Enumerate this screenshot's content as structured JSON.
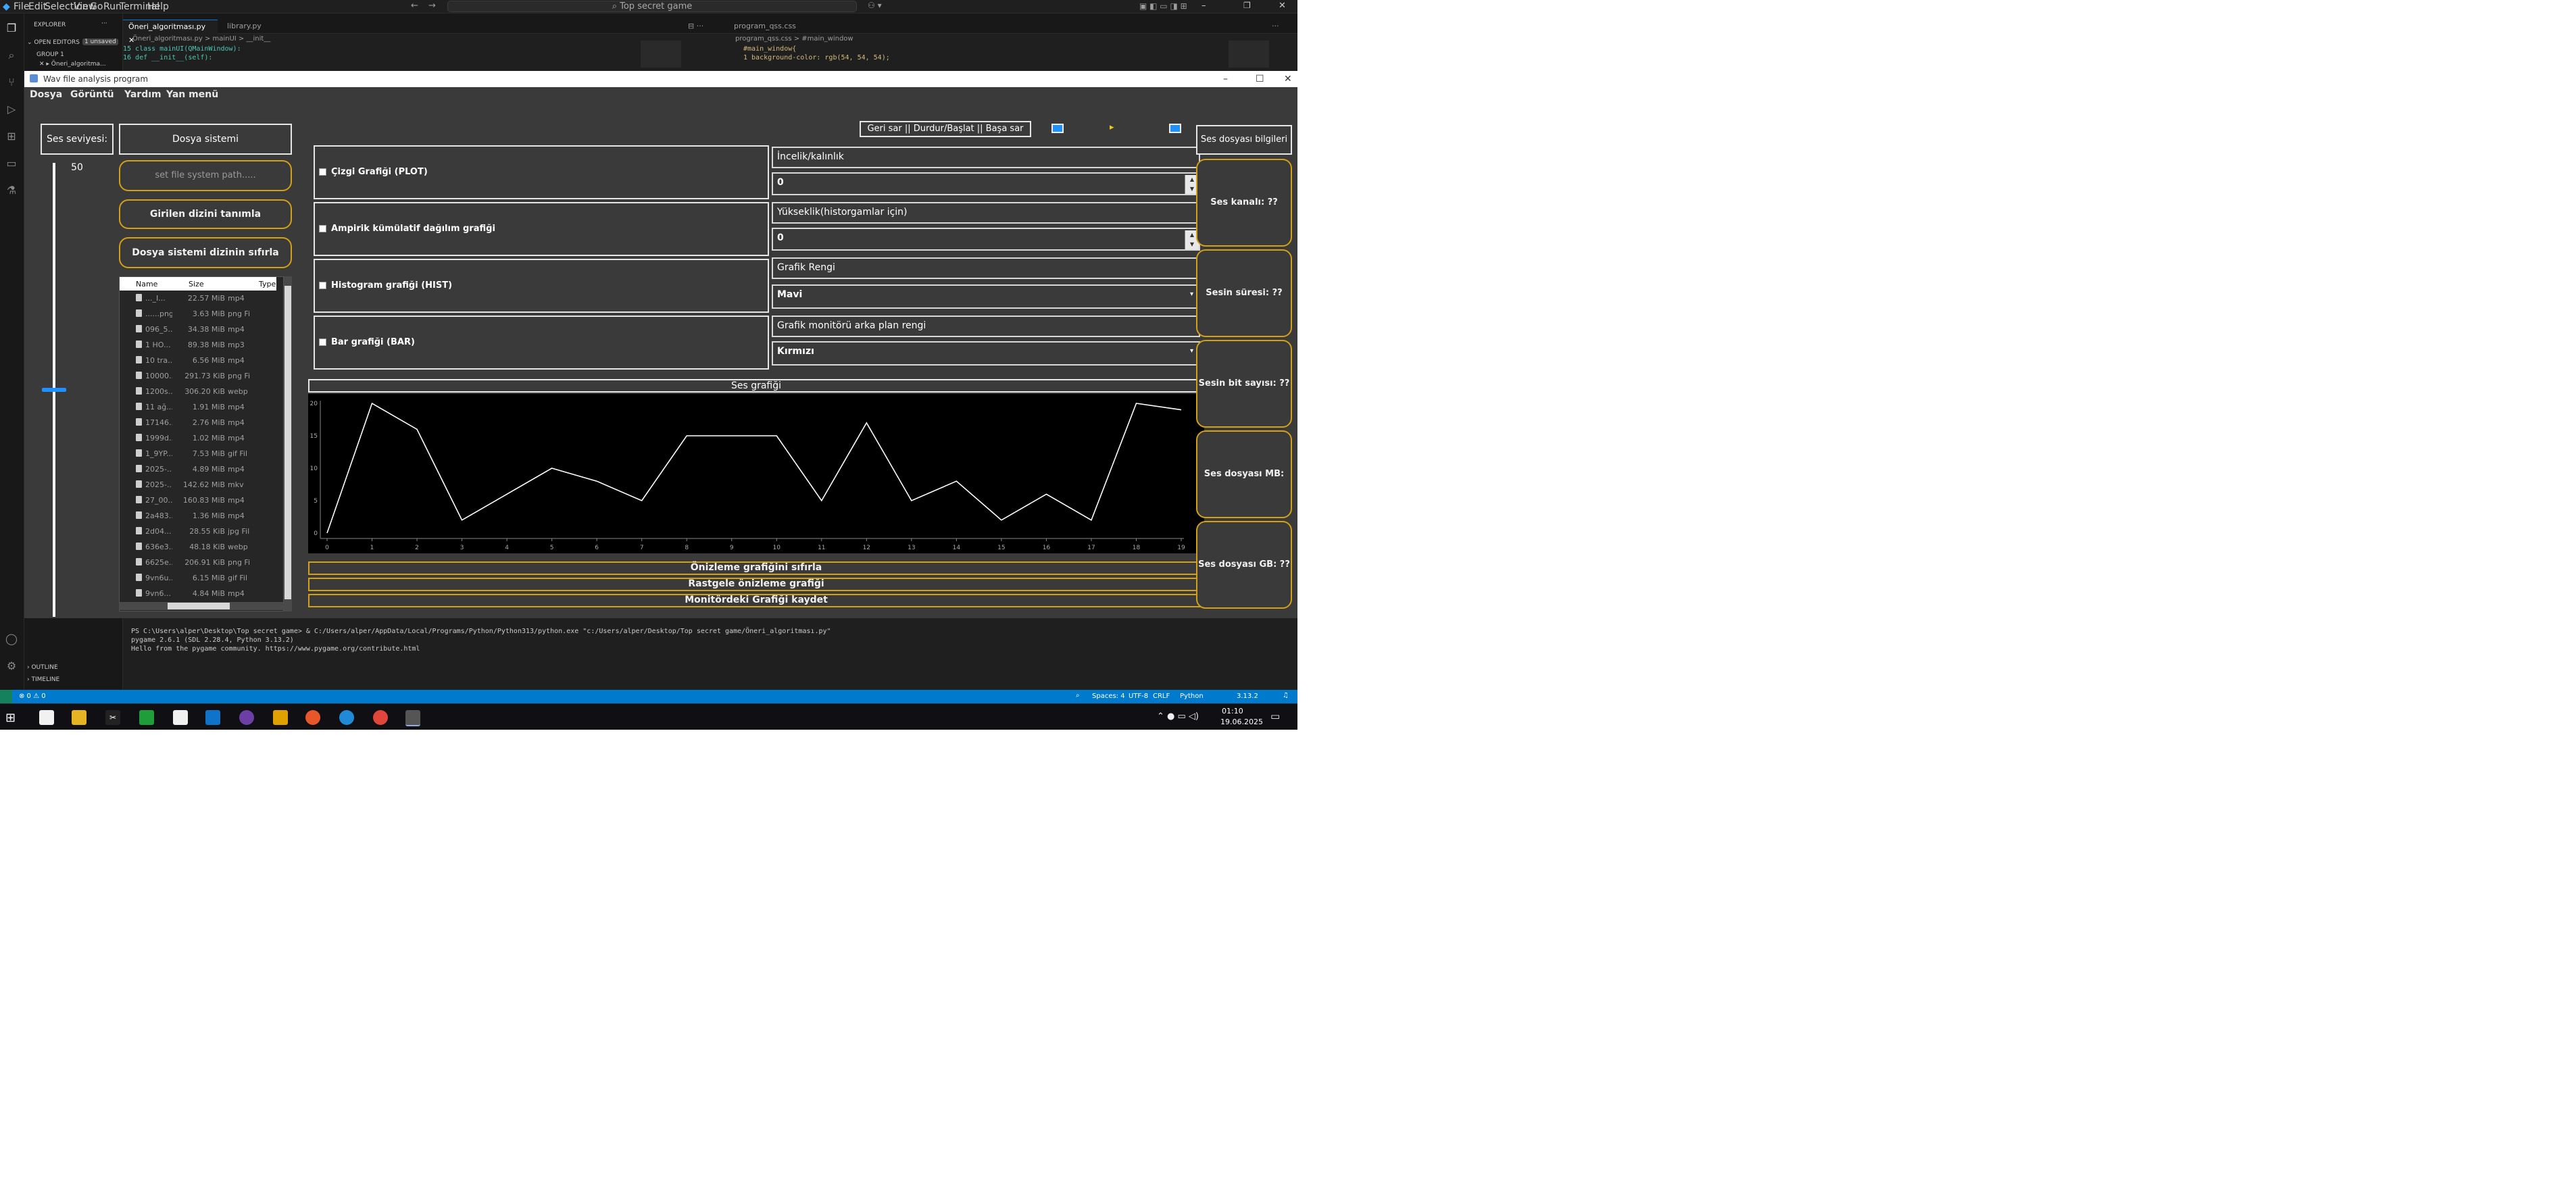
{
  "vscode": {
    "menu": [
      "File",
      "Edit",
      "Selection",
      "View",
      "Go",
      "Run",
      "Terminal",
      "Help"
    ],
    "search": "Top secret game",
    "explorer_title": "EXPLORER",
    "open_editors": "OPEN EDITORS",
    "unsaved_badge": "1 unsaved",
    "group": "GROUP 1",
    "open_file": "Öneri_algoritma...",
    "outline": "OUTLINE",
    "timeline": "TIMELINE",
    "tabs": [
      "Öneri_algoritması.py",
      "library.py",
      "program_qss.css"
    ],
    "breadcrumb_left": "Öneri_algoritması.py > mainUI > __init__",
    "breadcrumb_right": "program_qss.css > #main_window",
    "code_left": [
      "15    class mainUI(QMainWindow):",
      "16        def __init__(self):"
    ],
    "code_right": [
      "   #main_window{",
      "1      background-color: rgb(54, 54, 54);"
    ],
    "terminal": [
      "PS C:\\Users\\alper\\Desktop\\Top secret game> & C:/Users/alper/AppData/Local/Programs/Python/Python313/python.exe \"c:/Users/alper/Desktop/Top secret game/Öneri_algoritması.py\"",
      "pygame 2.6.1 (SDL 2.28.4, Python 3.13.2)",
      "Hello from the pygame community. https://www.pygame.org/contribute.html"
    ],
    "status_left": "⊗ 0 ⚠ 0",
    "status_right": [
      "Spaces: 4",
      "UTF-8",
      "CRLF",
      "Python",
      "3.13.2"
    ]
  },
  "taskbar": {
    "time": "01:10",
    "date": "19.06.2025"
  },
  "app": {
    "title": "Wav file analysis program",
    "menu": [
      "Dosya",
      "Görüntü",
      "Yardım",
      "Yan menü"
    ],
    "volume_label": "Ses seviyesi: 50",
    "volume_level_percent": 50,
    "file_system_title": "Dosya sistemi",
    "path_placeholder": "set file system path.....",
    "define_dir_button": "Girilen dizini tanımla",
    "reset_dir_button": "Dosya sistemi dizinin sıfırla",
    "file_table": {
      "headers": [
        "Name",
        "Size",
        "Type"
      ],
      "rows": [
        [
          "..._I...",
          "22.57 MiB",
          "mp4"
        ],
        [
          "......png",
          "3.63 MiB",
          "png Fi"
        ],
        [
          "096_5...",
          "34.38 MiB",
          "mp4"
        ],
        [
          "1 HO...",
          "89.38 MiB",
          "mp3"
        ],
        [
          "10 tra...",
          "6.56 MiB",
          "mp4"
        ],
        [
          "10000...",
          "291.73 KiB",
          "png Fi"
        ],
        [
          "1200s...",
          "306.20 KiB",
          "webp"
        ],
        [
          "11 ağ...",
          "1.91 MiB",
          "mp4"
        ],
        [
          "17146...",
          "2.76 MiB",
          "mp4"
        ],
        [
          "1999d...",
          "1.02 MiB",
          "mp4"
        ],
        [
          "1_9YP...",
          "7.53 MiB",
          "gif Fil"
        ],
        [
          "2025-...",
          "4.89 MiB",
          "mp4"
        ],
        [
          "2025-...",
          "142.62 MiB",
          "mkv"
        ],
        [
          "27_00...",
          "160.83 MiB",
          "mp4"
        ],
        [
          "2a483...",
          "1.36 MiB",
          "mp4"
        ],
        [
          "2d04...",
          "28.55 KiB",
          "jpg Fil"
        ],
        [
          "636e3...",
          "48.18 KiB",
          "webp"
        ],
        [
          "6625e...",
          "206.91 KiB",
          "png Fi"
        ],
        [
          "9vn6u...",
          "6.15 MiB",
          "gif Fil"
        ],
        [
          "9vn6...",
          "4.84 MiB",
          "mp4"
        ]
      ]
    },
    "graph_options": [
      "Çizgi Grafiği (PLOT)",
      "Ampirik kümülatif dağılım grafiği",
      "Histogram grafiği (HIST)",
      "Bar grafiği (BAR)"
    ],
    "thickness_label": "İncelik/kalınlık",
    "thickness_value": "0",
    "height_label": "Yükseklik(historgamlar için)",
    "height_value": "0",
    "color_label": "Grafik Rengi",
    "color_value": "Mavi",
    "bg_color_label": "Grafik monitörü arka plan rengi",
    "bg_color_value": "Kırmızı",
    "controls_label": "Geri sar || Durdur/Başlat || Başa sar",
    "graph_title": "Ses grafiği",
    "reset_preview_button": "Önizleme grafiğini sıfırla",
    "random_preview_button": "Rastgele önizleme grafiği",
    "save_graph_button": "Monitördeki Grafiği kaydet",
    "info_title": "Ses dosyası bilgileri",
    "info_items": [
      "Ses kanalı: ??",
      "Sesin süresi: ??",
      "Sesin bit sayısı: ??",
      "Ses dosyası MB: ??",
      "Ses dosyası GB: ??"
    ]
  },
  "chart_data": {
    "type": "line",
    "x": [
      0,
      1,
      2,
      3,
      4,
      5,
      6,
      7,
      8,
      9,
      10,
      11,
      12,
      13,
      14,
      15,
      16,
      17,
      18,
      19
    ],
    "values": [
      0,
      20,
      16,
      2,
      6,
      10,
      8,
      5,
      15,
      15,
      15,
      5,
      17,
      5,
      8,
      2,
      6,
      2,
      20,
      19
    ],
    "xlim": [
      0,
      19
    ],
    "ylim": [
      0,
      20
    ],
    "yticks": [
      0,
      5,
      10,
      15,
      20
    ],
    "line_color": "#ffffff",
    "background": "#000000",
    "grid": false
  }
}
